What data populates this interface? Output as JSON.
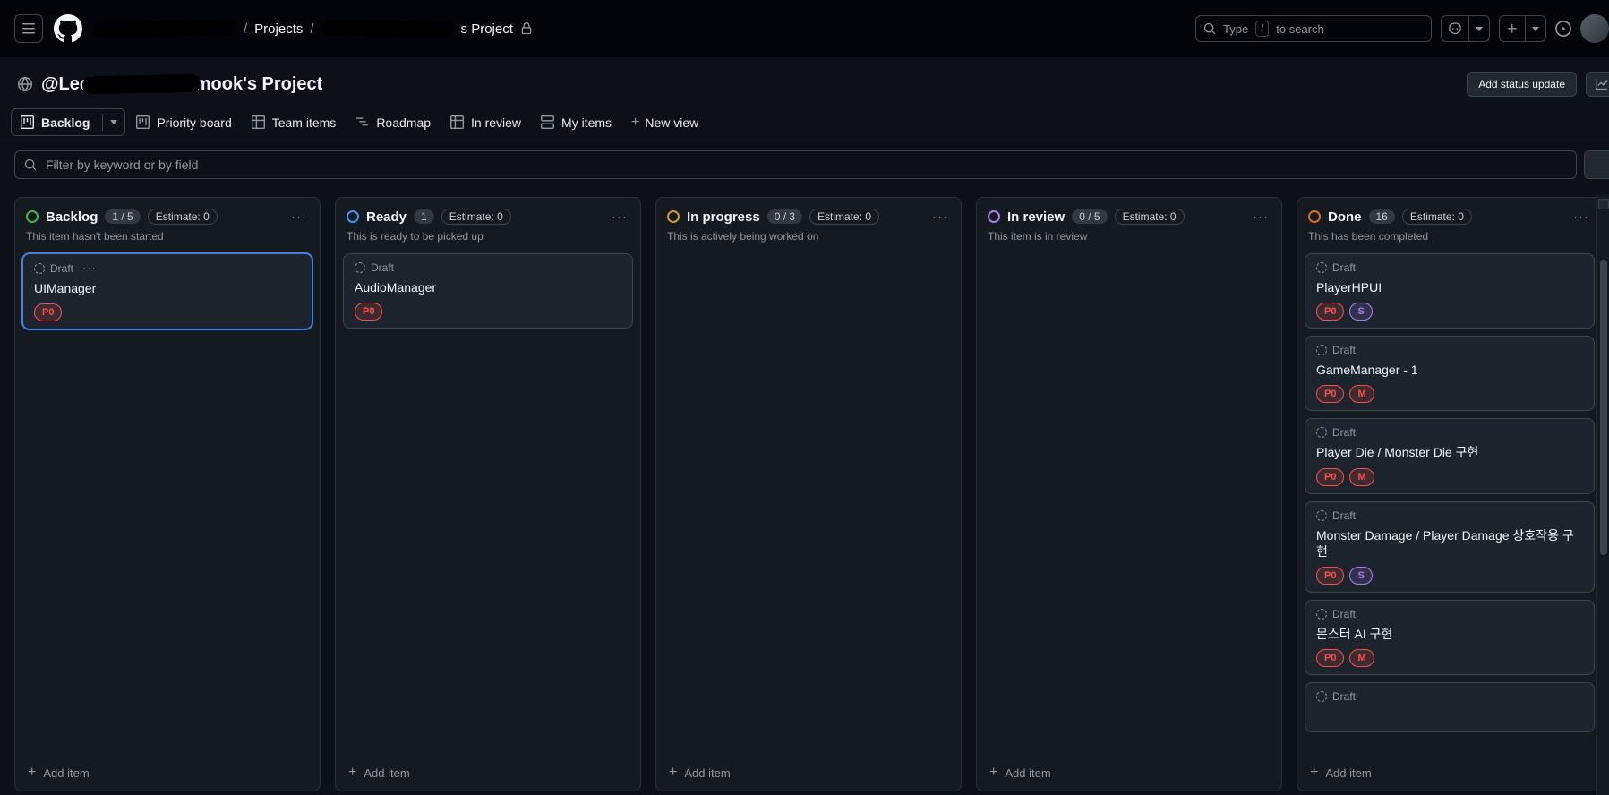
{
  "chrome": {
    "breadcrumb": {
      "link": "Projects",
      "separator": "/",
      "suffix": "s Project"
    },
    "search": {
      "text_before": "Type",
      "key": "/",
      "text_after": "to search"
    }
  },
  "project_header": {
    "title_part1": "@Leehyungwon",
    "title_part2": "dimook's Project",
    "add_status_label": "Add status update"
  },
  "tabs": {
    "items": [
      {
        "label": "Backlog",
        "icon": "project-icon",
        "active": true,
        "has_caret": true
      },
      {
        "label": "Priority board",
        "icon": "project-icon",
        "active": false
      },
      {
        "label": "Team items",
        "icon": "table-icon",
        "active": false
      },
      {
        "label": "Roadmap",
        "icon": "roadmap-icon",
        "active": false
      },
      {
        "label": "In review",
        "icon": "table-icon",
        "active": false
      },
      {
        "label": "My items",
        "icon": "rows-icon",
        "active": false
      }
    ],
    "new_view_label": "New view"
  },
  "filter": {
    "placeholder": "Filter by keyword or by field"
  },
  "icons": {
    "kebab": "···",
    "plus": "+",
    "caret": "▾"
  },
  "board": {
    "add_item_label": "Add item",
    "columns": [
      {
        "name": "Backlog",
        "count": "1 / 5",
        "estimate": "Estimate: 0",
        "description": "This item hasn't been started",
        "color": "#3fb950",
        "cards": [
          {
            "kind": "Draft",
            "title": "UIManager",
            "selected": true,
            "show_menu": true,
            "badges": [
              {
                "text": "P0",
                "color": "#f85149"
              }
            ]
          }
        ]
      },
      {
        "name": "Ready",
        "count": "1",
        "estimate": "Estimate: 0",
        "description": "This is ready to be picked up",
        "color": "#4493f8",
        "cards": [
          {
            "kind": "Draft",
            "title": "AudioManager",
            "badges": [
              {
                "text": "P0",
                "color": "#f85149"
              }
            ]
          }
        ]
      },
      {
        "name": "In progress",
        "count": "0 / 3",
        "estimate": "Estimate: 0",
        "description": "This is actively being worked on",
        "color": "#d29922",
        "cards": []
      },
      {
        "name": "In review",
        "count": "0 / 5",
        "estimate": "Estimate: 0",
        "description": "This item is in review",
        "color": "#ab7df8",
        "cards": []
      },
      {
        "name": "Done",
        "count": "16",
        "estimate": "Estimate: 0",
        "description": "This has been completed",
        "color": "#db6d28",
        "cards": [
          {
            "kind": "Draft",
            "title": "PlayerHPUI",
            "badges": [
              {
                "text": "P0",
                "color": "#f85149"
              },
              {
                "text": "S",
                "color": "#ab7df8"
              }
            ]
          },
          {
            "kind": "Draft",
            "title": "GameManager - 1",
            "badges": [
              {
                "text": "P0",
                "color": "#f85149"
              },
              {
                "text": "M",
                "color": "#f85149"
              }
            ]
          },
          {
            "kind": "Draft",
            "title": "Player Die / Monster Die 구현",
            "badges": [
              {
                "text": "P0",
                "color": "#f85149"
              },
              {
                "text": "M",
                "color": "#f85149"
              }
            ]
          },
          {
            "kind": "Draft",
            "title": "Monster Damage / Player Damage 상호작용 구현",
            "badges": [
              {
                "text": "P0",
                "color": "#f85149"
              },
              {
                "text": "S",
                "color": "#ab7df8"
              }
            ]
          },
          {
            "kind": "Draft",
            "title": "몬스터 AI 구현",
            "badges": [
              {
                "text": "P0",
                "color": "#f85149"
              },
              {
                "text": "M",
                "color": "#f85149"
              }
            ]
          },
          {
            "kind": "Draft",
            "title": "",
            "partial": true,
            "badges": []
          }
        ]
      }
    ]
  }
}
